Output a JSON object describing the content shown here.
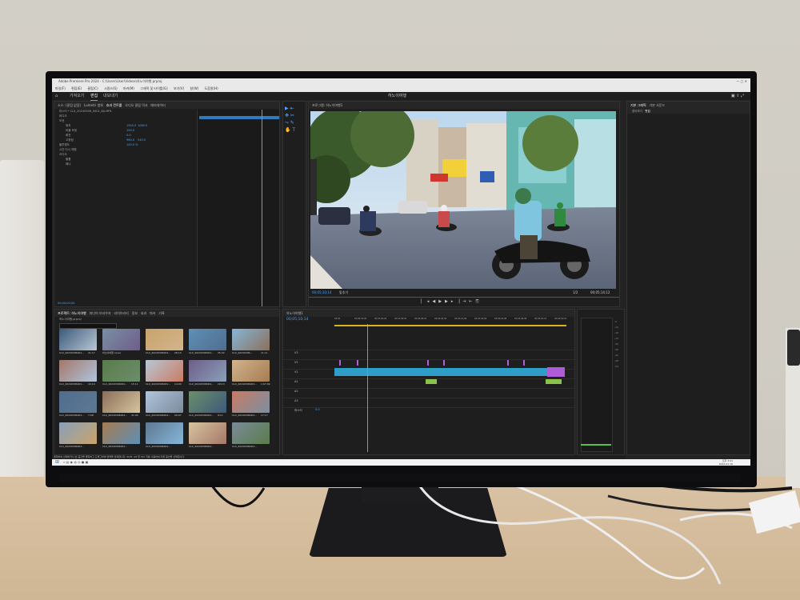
{
  "app": {
    "title_bar": "Adobe Premiere Pro 2024 - C:\\Users\\User\\Videos\\하노이여행.prproj",
    "menu": [
      "파일(F)",
      "편집(E)",
      "클립(C)",
      "시퀀스(S)",
      "마커(M)",
      "그래픽 및 타이틀(G)",
      "보기(V)",
      "창(W)",
      "도움말(H)"
    ],
    "workspace_tabs": [
      "가져오기",
      "편집",
      "내보내기"
    ],
    "project_name": "하노이여행"
  },
  "source_panel": {
    "tabs": [
      "소스: (클립 없음)",
      "Lumetri 범위",
      "효과 컨트롤",
      "오디오 클립 믹서",
      "메타데이터"
    ],
    "clip_line": "마스터 * CLX_20240306_0001_DJI.MP4",
    "properties": [
      "비디오",
      "모션",
      "위치",
      "비율 조정",
      "회전",
      "고정점",
      "불투명도",
      "시간 다시 매핑",
      "오디오",
      "볼륨",
      "패너"
    ],
    "values": [
      "1920.0",
      "1080.0",
      "100.0",
      "0.0",
      "960.0",
      "540.0",
      "100.0 %"
    ],
    "timecode": "00;00;00;00"
  },
  "program_monitor": {
    "tab": "프로그램: 하노이여행1",
    "timecode_left": "00;05;10;14",
    "fit_label": "맞추기",
    "quality": "1/2",
    "timecode_right": "00;05;14;12"
  },
  "project_panel": {
    "tabs": [
      "프로젝트: 하노이여행",
      "미디어 브라우저",
      "라이브러리",
      "정보",
      "효과",
      "마커",
      "기록"
    ],
    "file": "하노이여행.prproj",
    "items": [
      {
        "label": "CLX_20240306001...",
        "dur": "21:17"
      },
      {
        "label": "하노이여행 cover",
        "dur": ""
      },
      {
        "label": "CLX_20240306001...",
        "dur": "28:10"
      },
      {
        "label": "CLX_20240306001...",
        "dur": "35:22"
      },
      {
        "label": "CLX_20240306...",
        "dur": "11:11"
      },
      {
        "label": "CLX_20240306001...",
        "dur": "10:19"
      },
      {
        "label": "CLX_20240306001...",
        "dur": "15:11"
      },
      {
        "label": "CLX_20240306001...",
        "dur": "14:09"
      },
      {
        "label": "CLX_20240306001...",
        "dur": "29:13"
      },
      {
        "label": "CLX_20240306001...",
        "dur": "1:07:09"
      },
      {
        "label": "CLX_20240306001...",
        "dur": "7:08"
      },
      {
        "label": "CLX_20240306001...",
        "dur": "31:00"
      },
      {
        "label": "CLX_20240306001...",
        "dur": "20:07"
      },
      {
        "label": "CLX_20240306001...",
        "dur": "9:11"
      },
      {
        "label": "CLX_20240306001...",
        "dur": "17:17"
      },
      {
        "label": "CLX_20240306001...",
        "dur": ""
      },
      {
        "label": "CLX_20240306001...",
        "dur": ""
      },
      {
        "label": "CLX_20240306001...",
        "dur": ""
      },
      {
        "label": "CLX_20240306001...",
        "dur": ""
      },
      {
        "label": "CLX_20240306001...",
        "dur": ""
      }
    ]
  },
  "timeline": {
    "tab": "하노이여행1",
    "timecode": "00;05;10;14",
    "ruler": [
      "00;00",
      "00;00;32;00",
      "00;01;04;02",
      "00;01;36;02",
      "00;02;08;04",
      "00;02;40;04",
      "00;03;12;06",
      "00;03;44;06",
      "00;04;16;08",
      "00;04;48;08",
      "00;05;20;10",
      "00;05;52;10"
    ],
    "tracks": [
      "V3",
      "V2",
      "V1",
      "A1",
      "A2",
      "A3",
      "마스터"
    ],
    "master_value": "0.0"
  },
  "right_panel": {
    "tabs": [
      "기본 그래픽",
      "기본 사운드"
    ],
    "subtabs": [
      "찾아보기",
      "편집"
    ]
  },
  "status_bar": "클릭하여 선택하거나 빈 공간을 클릭하고 드래그하여 영역을 선택합니다. Shift, Alt 및 Ctrl 키를 사용하여 다른 옵션을 선택합니다.",
  "taskbar": {
    "time": "오후 3:41",
    "date": "2024-03-16"
  },
  "colors": {
    "accent": "#4aa3ff",
    "clip_video": "#2e9ec9",
    "clip_audio": "#8bc34a",
    "clip_adjust": "#b05cd6",
    "panel_bg": "#1e1e1e"
  }
}
